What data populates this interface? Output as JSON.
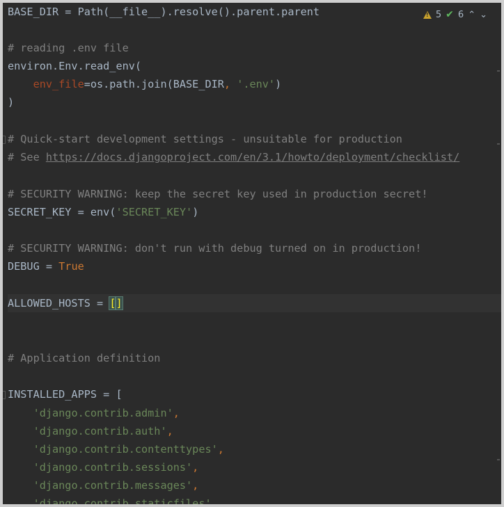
{
  "inspection": {
    "warnings": "5",
    "ok": "6",
    "up_label": "^",
    "down_label": "v"
  },
  "code": {
    "l1": {
      "a": "BASE_DIR = Path(__file__).resolve().parent.parent"
    },
    "l3": {
      "a": "# reading .env file"
    },
    "l4": {
      "a": "environ.Env.read_env("
    },
    "l5": {
      "a": "    ",
      "b": "env_file",
      "c": "=os.path.join(BASE_DIR",
      "d": ", ",
      "e": "'.env'",
      "f": ")"
    },
    "l6": {
      "a": ")"
    },
    "l8": {
      "a": "# Quick-start development settings - unsuitable for production"
    },
    "l9": {
      "a": "# See ",
      "b": "https://docs.djangoproject.com/en/3.1/howto/deployment/checklist/"
    },
    "l11": {
      "a": "# SECURITY WARNING: keep the secret key used in production secret!"
    },
    "l12": {
      "a": "SECRET_KEY = env(",
      "b": "'SECRET_KEY'",
      "c": ")"
    },
    "l14": {
      "a": "# SECURITY WARNING: don't run with debug turned on in production!"
    },
    "l15": {
      "a": "DEBUG = ",
      "b": "True"
    },
    "l17": {
      "a": "ALLOWED_HOSTS = ",
      "b": "[",
      "c": "]"
    },
    "l20": {
      "a": "# Application definition"
    },
    "l22": {
      "a": "INSTALLED_APPS = ["
    },
    "apps": [
      {
        "name": "'django.contrib.admin'",
        "sep": ","
      },
      {
        "name": "'django.contrib.auth'",
        "sep": ","
      },
      {
        "name": "'django.contrib.contenttypes'",
        "sep": ","
      },
      {
        "name": "'django.contrib.sessions'",
        "sep": ","
      },
      {
        "name": "'django.contrib.messages'",
        "sep": ","
      },
      {
        "name": "'django.contrib.staticfiles'",
        "sep": ","
      }
    ]
  }
}
